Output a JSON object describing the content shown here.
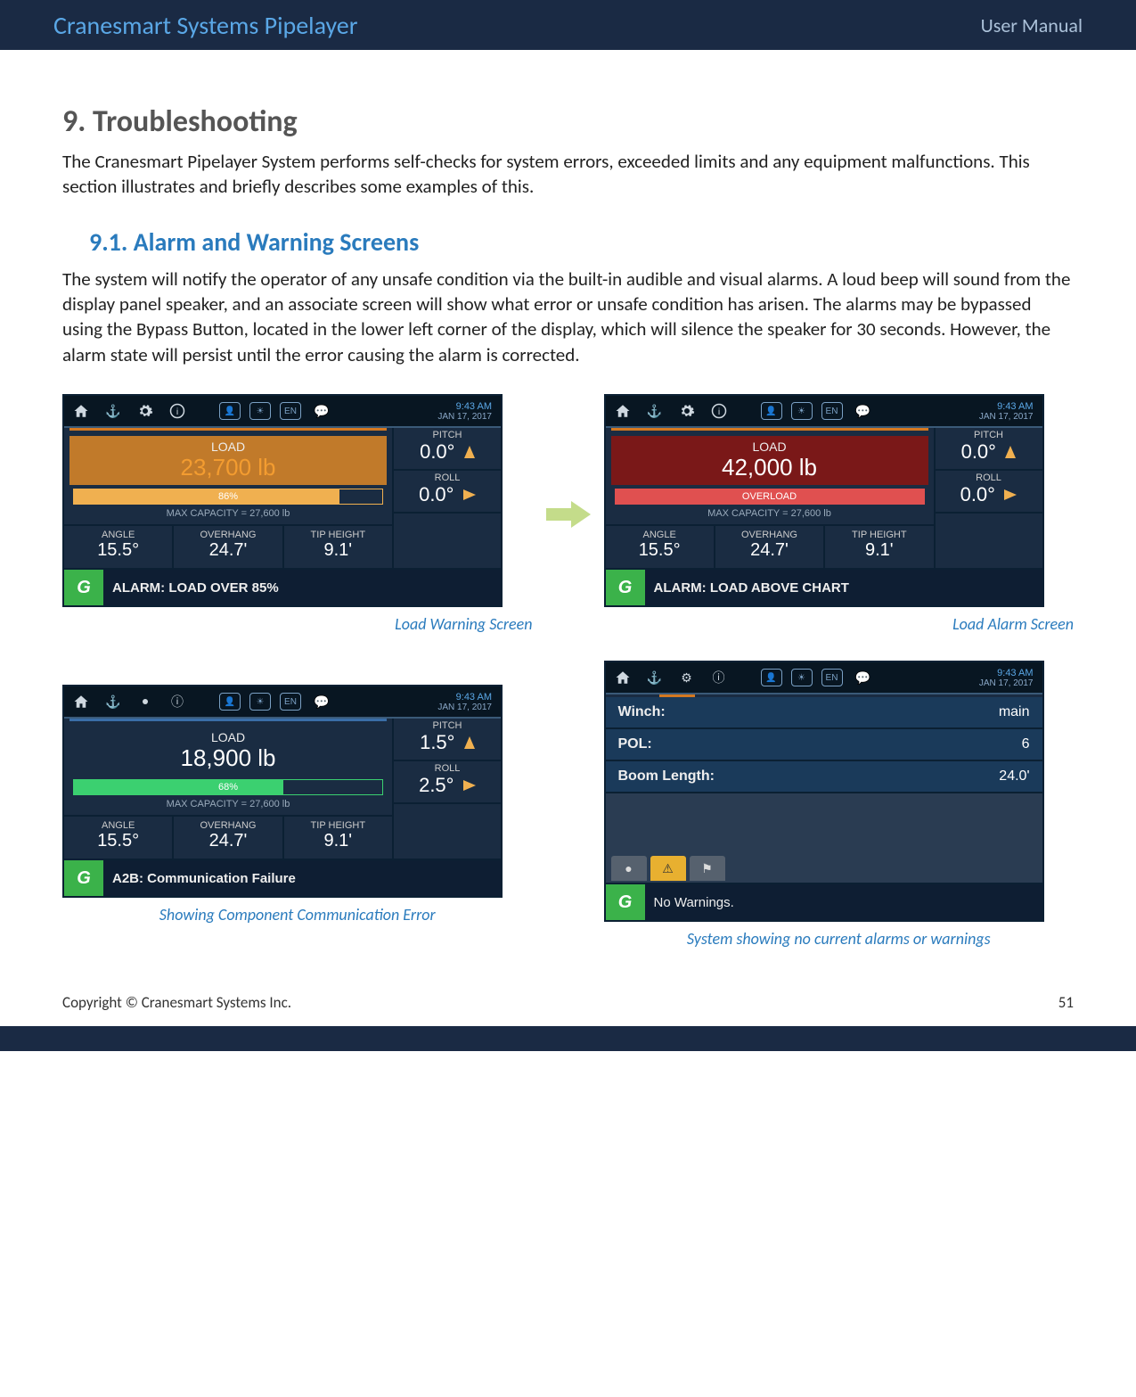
{
  "header": {
    "left": "Cranesmart Systems Pipelayer",
    "right": "User Manual"
  },
  "section": {
    "title": "9. Troubleshooting",
    "intro": "The Cranesmart Pipelayer System performs self-checks for system errors, exceeded limits and any equipment malfunctions.  This section illustrates and briefly describes some examples of this.",
    "sub_title": "9.1. Alarm and Warning Screens",
    "sub_body": "The system will notify the operator of any unsafe condition via the built-in audible and visual alarms.  A loud beep will sound from the display panel speaker, and an associate screen will show what error or unsafe condition has arisen.  The alarms may be bypassed using the Bypass Button, located in the lower left corner of the display, which will silence the speaker for 30 seconds.  However, the alarm state will persist until the error causing the alarm is corrected."
  },
  "common": {
    "time": "9:43 AM",
    "date": "JAN 17, 2017",
    "lang": "EN",
    "load_label": "LOAD",
    "pitch_label": "PITCH",
    "roll_label": "ROLL",
    "angle_label": "ANGLE",
    "overhang_label": "OVERHANG",
    "tip_label": "TIP HEIGHT",
    "angle_value": "15.5°",
    "overhang_value": "24.7'",
    "tip_value": "9.1'",
    "max_capacity": "MAX CAPACITY = 27,600 lb",
    "gc": "G"
  },
  "screens": {
    "warning": {
      "caption": "Load Warning Screen",
      "load_value": "23,700 lb",
      "bar_text": "86%",
      "bar_width": "86%",
      "pitch": "0.0°",
      "roll": "0.0°",
      "alarm": "ALARM: LOAD OVER 85%"
    },
    "alarm": {
      "caption": "Load Alarm Screen",
      "load_value": "42,000 lb",
      "bar_text": "OVERLOAD",
      "bar_width": "100%",
      "pitch": "0.0°",
      "roll": "0.0°",
      "alarm": "ALARM: LOAD ABOVE CHART"
    },
    "comm": {
      "caption": "Showing Component Communication Error",
      "load_value": "18,900 lb",
      "bar_text": "68%",
      "bar_width": "68%",
      "pitch": "1.5°",
      "roll": "2.5°",
      "alarm": "A2B: Communication Failure"
    },
    "nowarn": {
      "caption": "System showing no current alarms or warnings",
      "rows": {
        "winch_label": "Winch:",
        "winch_val": "main",
        "pol_label": "POL:",
        "pol_val": "6",
        "boom_label": "Boom Length:",
        "boom_val": "24.0'"
      },
      "status": "No Warnings."
    }
  },
  "footer": {
    "left": "Copyright © Cranesmart Systems Inc.",
    "right": "51"
  }
}
